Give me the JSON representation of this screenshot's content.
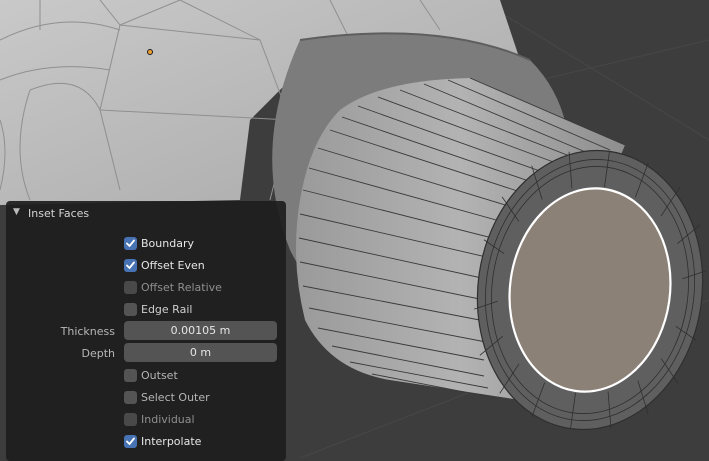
{
  "panel": {
    "title": "Inset Faces",
    "options": {
      "boundary": {
        "label": "Boundary",
        "checked": true
      },
      "offset_even": {
        "label": "Offset Even",
        "checked": true
      },
      "offset_relative": {
        "label": "Offset Relative",
        "checked": false
      },
      "edge_rail": {
        "label": "Edge Rail",
        "checked": false
      },
      "outset": {
        "label": "Outset",
        "checked": false
      },
      "select_outer": {
        "label": "Select Outer",
        "checked": false
      },
      "individual": {
        "label": "Individual",
        "checked": false
      },
      "interpolate": {
        "label": "Interpolate",
        "checked": true
      }
    },
    "thickness": {
      "label": "Thickness",
      "value": "0.00105 m"
    },
    "depth": {
      "label": "Depth",
      "value": "0 m"
    }
  },
  "colors": {
    "checkbox_on": "#4772b3",
    "inset_face": "#8c8177",
    "viewport_bg": "#3d3d3d",
    "origin_dot": "#f0a030"
  },
  "icons": {
    "panel_toggle": "chevron-down-icon",
    "checkmark": "checkmark-icon"
  }
}
